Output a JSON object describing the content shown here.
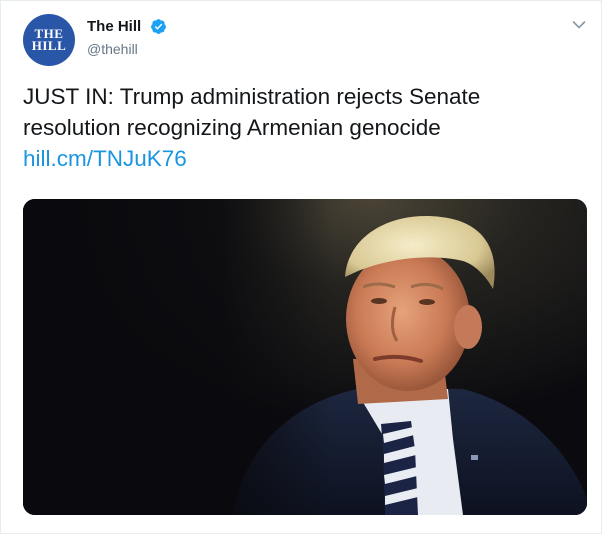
{
  "tweet": {
    "account": {
      "avatar_line1": "THE",
      "avatar_line2": "HILL",
      "display_name": "The Hill",
      "handle": "@thehill",
      "verified": true
    },
    "text": "JUST IN: Trump administration rejects Senate resolution recognizing Armenian genocide",
    "link": "hill.cm/TNJuK76",
    "media": {
      "alt": "Photo of Donald Trump"
    },
    "menu_icon": "chevron-down-icon",
    "verified_icon": "verified-badge-icon"
  },
  "colors": {
    "text": "#14171a",
    "secondary": "#657786",
    "link": "#1b95e0",
    "verified": "#1da1f2",
    "avatar_bg": "#2a56a8",
    "border": "#e6ecf0"
  }
}
